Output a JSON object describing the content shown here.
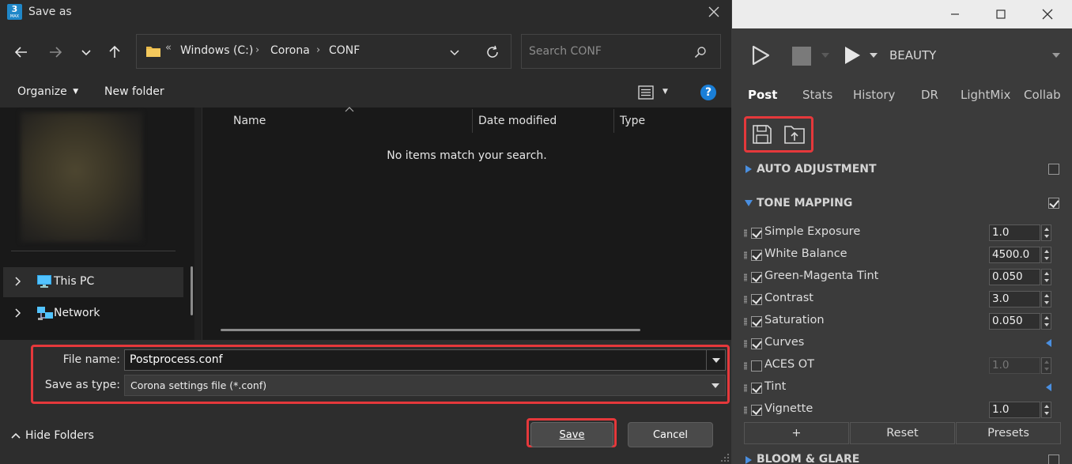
{
  "dialog": {
    "title": "Save as",
    "app_icon_text": "3",
    "app_icon_sub": "MAX",
    "address": {
      "overflow": "«",
      "crumbs": [
        "Windows (C:)",
        "Corona",
        "CONF"
      ]
    },
    "search_placeholder": "Search CONF",
    "toolbar": {
      "organize_label": "Organize",
      "new_folder_label": "New folder",
      "help_label": "?"
    },
    "nav": {
      "items": [
        {
          "label": "This PC"
        },
        {
          "label": "Network"
        }
      ]
    },
    "columns": [
      "Name",
      "Date modified",
      "Type"
    ],
    "empty_message": "No items match your search.",
    "form": {
      "file_name_label": "File name:",
      "file_name_value": "Postprocess.conf",
      "save_type_label": "Save as type:",
      "save_type_value": "Corona settings file (*.conf)"
    },
    "hide_folders_label": "Hide Folders",
    "save_label": "Save",
    "cancel_label": "Cancel",
    "highlight_color": "#e5383b"
  },
  "vfb": {
    "render_element": "BEAUTY",
    "tabs": [
      "Post",
      "Stats",
      "History",
      "DR",
      "LightMix",
      "Collab"
    ],
    "active_tab": "Post",
    "icons": [
      "save-icon",
      "load-icon"
    ],
    "sections": {
      "auto_adjustment": "AUTO ADJUSTMENT",
      "tone_mapping": "TONE MAPPING",
      "bloom_glare": "BLOOM & GLARE"
    },
    "params": [
      {
        "label": "Simple Exposure",
        "checked": true,
        "value": "1.0"
      },
      {
        "label": "White Balance",
        "checked": true,
        "value": "4500.0"
      },
      {
        "label": "Green-Magenta Tint",
        "checked": true,
        "value": "0.050"
      },
      {
        "label": "Contrast",
        "checked": true,
        "value": "3.0"
      },
      {
        "label": "Saturation",
        "checked": true,
        "value": "0.050"
      },
      {
        "label": "Curves",
        "checked": true,
        "value": null
      },
      {
        "label": "ACES OT",
        "checked": false,
        "value": "1.0"
      },
      {
        "label": "Tint",
        "checked": true,
        "value": null
      },
      {
        "label": "Vignette",
        "checked": true,
        "value": "1.0"
      }
    ],
    "buttons": {
      "add_label": "+",
      "reset_label": "Reset",
      "presets_label": "Presets"
    }
  }
}
